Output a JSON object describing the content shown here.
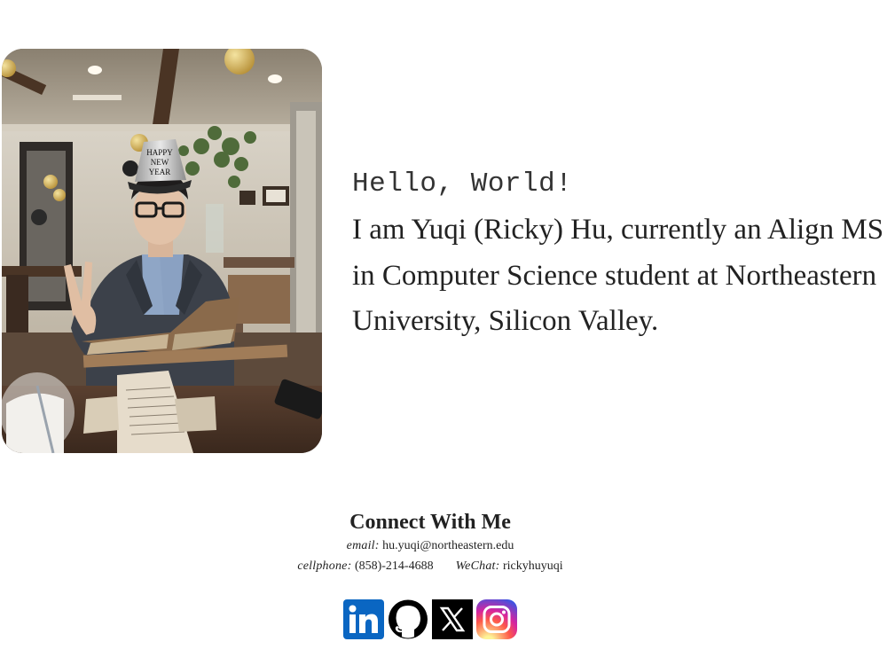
{
  "photo": {
    "alt": "Portrait of Yuqi Hu at a restaurant table wearing a Happy New Year party hat",
    "hat_text_line1": "HAPPY",
    "hat_text_line2": "NEW",
    "hat_text_line3": "YEAR"
  },
  "intro": {
    "greeting": "Hello, World!",
    "bio": "I am Yuqi (Ricky) Hu, currently an Align MS in Computer Science student at Northeastern University, Silicon Valley."
  },
  "connect": {
    "title": "Connect With Me",
    "email_label": "email:",
    "email_value": "hu.yuqi@northeastern.edu",
    "phone_label": "cellphone:",
    "phone_value": "(858)-214-4688",
    "wechat_label": "WeChat:",
    "wechat_value": "rickyhuyuqi"
  },
  "socials": [
    {
      "name": "linkedin-icon",
      "color": "#0a66c2"
    },
    {
      "name": "github-icon",
      "color": "#000000"
    },
    {
      "name": "x-icon",
      "color": "#000000"
    },
    {
      "name": "instagram-icon",
      "color": "#d6249f"
    }
  ]
}
